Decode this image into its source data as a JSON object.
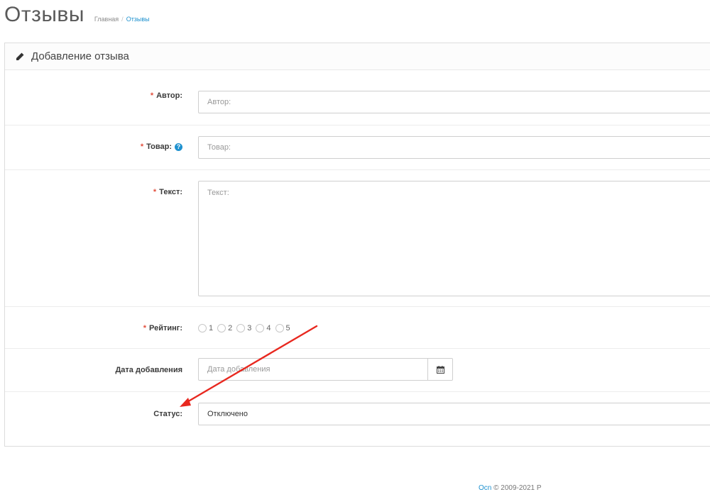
{
  "header": {
    "title": "Отзывы",
    "breadcrumb": [
      "Главная",
      "Отзывы"
    ]
  },
  "panel": {
    "title": "Добавление отзыва"
  },
  "form": {
    "author": {
      "label": "Автор:",
      "placeholder": "Автор:",
      "required": true
    },
    "product": {
      "label": "Товар:",
      "placeholder": "Товар:",
      "required": true,
      "help": "?"
    },
    "text": {
      "label": "Текст:",
      "placeholder": "Текст:",
      "required": true
    },
    "rating": {
      "label": "Рейтинг:",
      "required": true,
      "options": [
        "1",
        "2",
        "3",
        "4",
        "5"
      ]
    },
    "date_added": {
      "label": "Дата добавления",
      "placeholder": "Дата добавления"
    },
    "status": {
      "label": "Статус:",
      "value": "Отключено"
    },
    "required_marker": "*"
  },
  "footer": {
    "link": "Ocn",
    "text": "© 2009-2021 P"
  },
  "colors": {
    "accent": "#1e91cf",
    "required": "#e3503e",
    "annotation_arrow": "#e8281f"
  },
  "icons": {
    "panel": "pencil-icon",
    "date": "calendar-icon",
    "help": "question-circle-icon"
  }
}
